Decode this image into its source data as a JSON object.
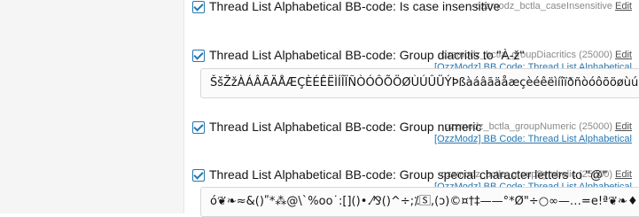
{
  "options": [
    {
      "var_name": "ozzmodz_bctla_caseInsensitive",
      "var_name_suffix": "",
      "edit_label": "Edit",
      "addon_link": "",
      "label": "Thread List Alphabetical BB-code: Is case insensitive",
      "checked": true,
      "value": ""
    },
    {
      "var_name": "ozzmodz_bctla_groupDiacritics",
      "var_name_suffix": "(25000)",
      "edit_label": "Edit",
      "addon_link": "[OzzModz] BB Code: Thread List Alphabetical",
      "label": "Thread List Alphabetical BB-code: Group diacritis to \"À-ž\"",
      "checked": true,
      "value": "ŠšŽžÀÁÂÃÄÅÆÇÈÉÊËÌÍÎÏÑÒÓÔÕÖØÙÚÛÜÝÞßàáâãäåæçèéêëìíîïðñòóôõöøùúûýþÿ"
    },
    {
      "var_name": "ozzmodz_bctla_groupNumeric",
      "var_name_suffix": "(25000)",
      "edit_label": "Edit",
      "addon_link": "[OzzModz] BB Code: Thread List Alphabetical",
      "label": "Thread List Alphabetical BB-code: Group numeric",
      "checked": true,
      "value": ""
    },
    {
      "var_name": "ozzmodz_bctla_groupSymbolic",
      "var_name_suffix": "(25000)",
      "edit_label": "Edit",
      "addon_link": "[OzzModz] BB Code: Thread List Alphabetical",
      "label": "Thread List Alphabetical BB-code: Group special character letters to \"@\"",
      "checked": true,
      "value": "ó❦❧≈&()ʺ*⁂@\\`%oo˙:[]()•.⁄⅋()^÷;⁒🅂,(ɔ)©¤†‡——°*Ø\"÷○∞—…=e!ª❦❧♦.♀♂♆`◌«»❦❧♦"
    }
  ]
}
